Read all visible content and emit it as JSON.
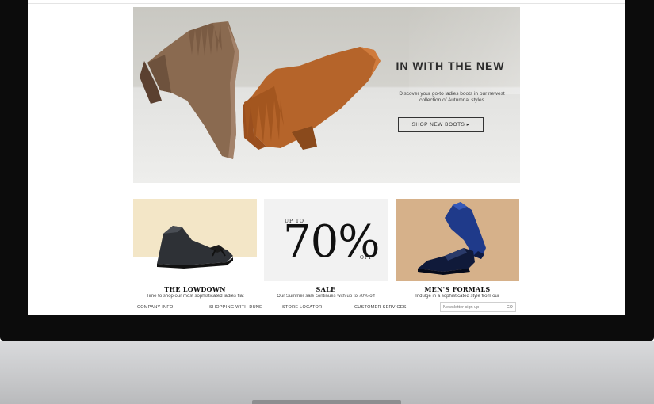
{
  "hero": {
    "title": "IN WITH THE NEW",
    "text_line1": "Discover your go-to ladies boots in our newest",
    "text_line2": "collection of Autumnal styles",
    "button_label": "SHOP NEW BOOTS ▸"
  },
  "tiles": [
    {
      "title": "THE LOWDOWN",
      "description": "Time to shop our most sophisticated ladies flat"
    },
    {
      "title": "SALE",
      "description": "Our Summer sale continues with up to 70% off",
      "promo_prefix": "UP TO",
      "promo_value": "70%",
      "promo_suffix": "OFF"
    },
    {
      "title": "MEN'S FORMALS",
      "description": "Indulge in a sophisticated style from our"
    }
  ],
  "footer": {
    "links": [
      "COMPANY INFO",
      "SHOPPING WITH DUNE",
      "STORE LOCATOR",
      "CUSTOMER SERVICES"
    ],
    "newsletter_placeholder": "Newsletter sign up",
    "newsletter_submit": "GO"
  },
  "colors": {
    "bezel": "#0c0c0c",
    "boot_brown": "#8a6a50",
    "boot_tan": "#b5642a"
  }
}
